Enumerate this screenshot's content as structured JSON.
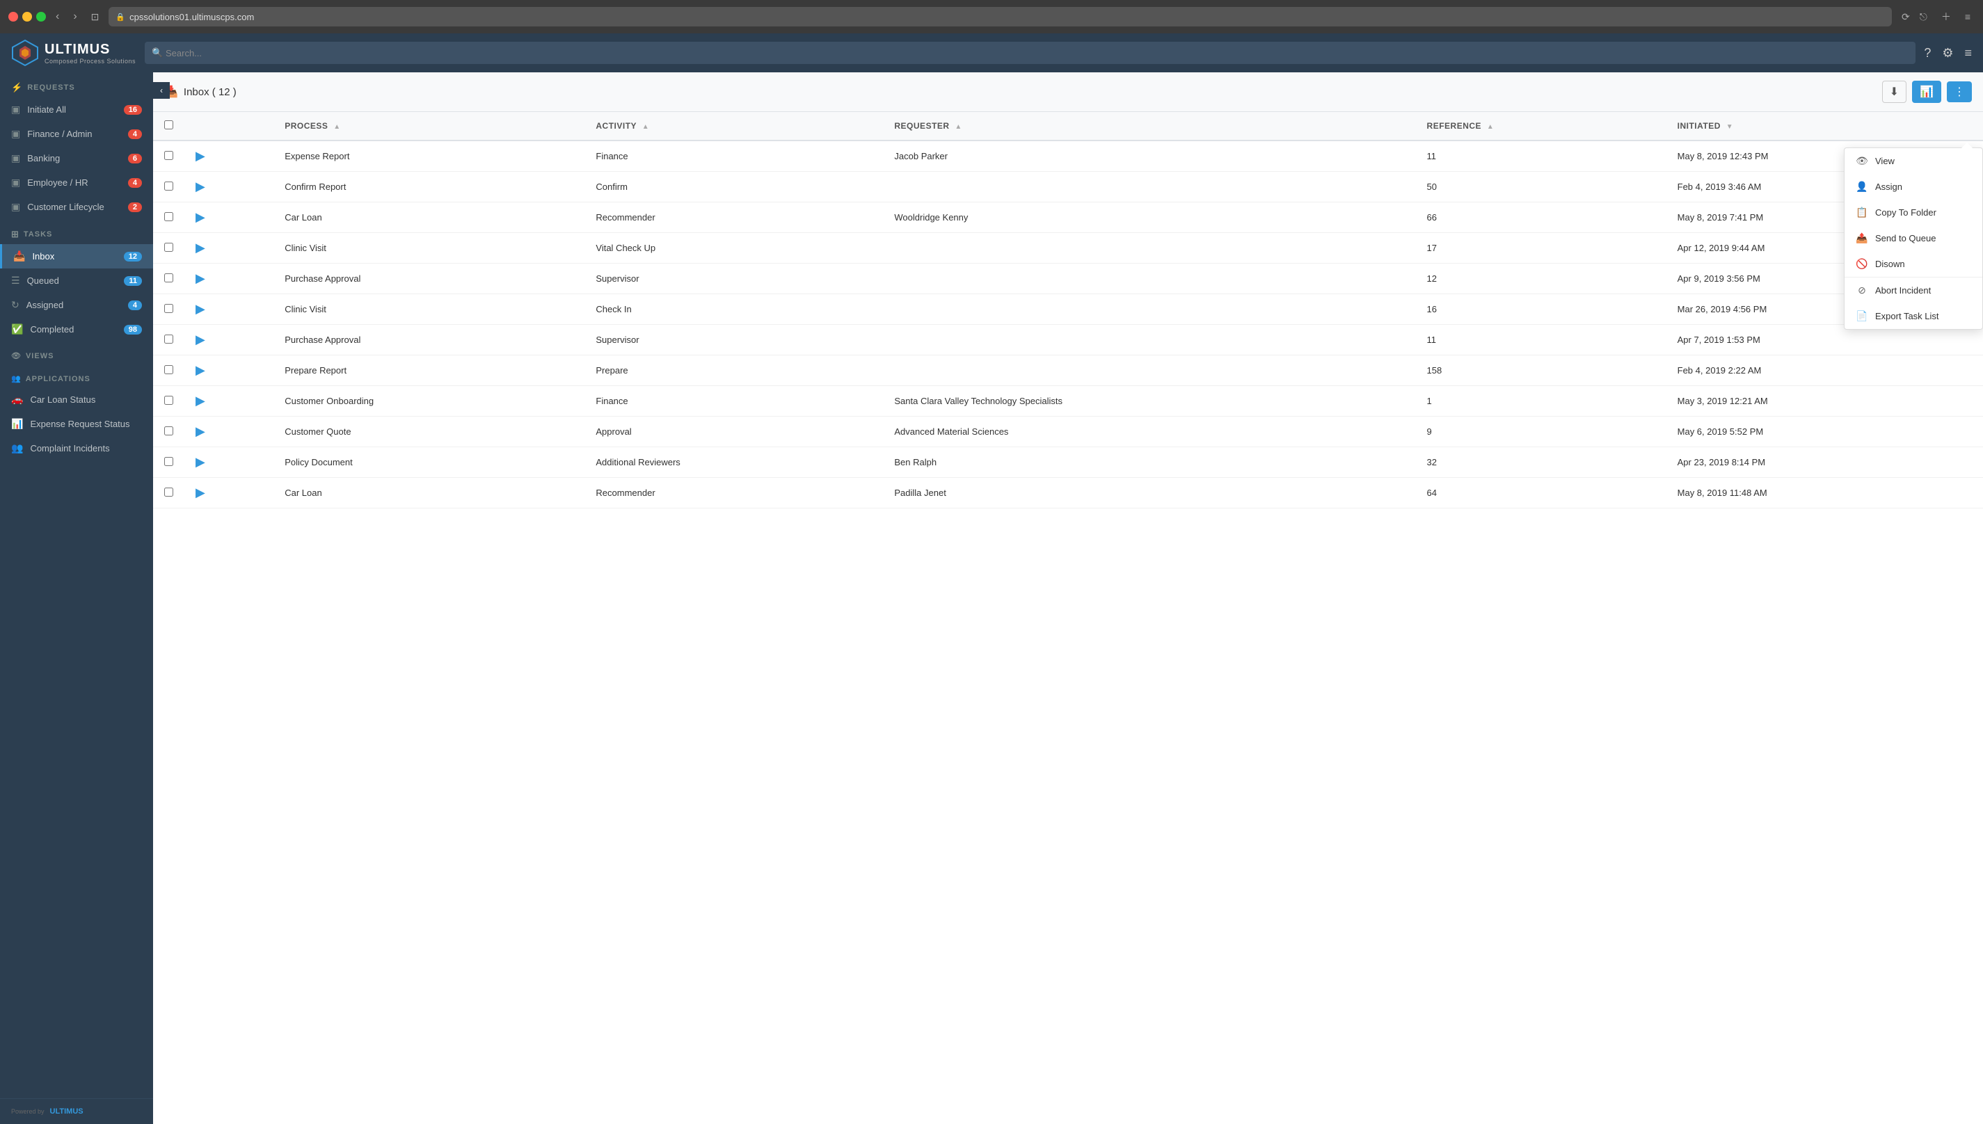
{
  "browser": {
    "url": "cpssolutions01.ultimuscps.com",
    "reload_label": "⟳"
  },
  "header": {
    "logo_name": "ULTIMUS",
    "logo_subtitle": "Composed Process Solutions",
    "search_placeholder": "Search...",
    "help_label": "?",
    "settings_label": "⚙",
    "menu_label": "≡"
  },
  "sidebar": {
    "requests_label": "REQUESTS",
    "tasks_label": "TASKS",
    "views_label": "VIEWS",
    "applications_label": "APPLICATIONS",
    "requests_items": [
      {
        "id": "initiate-all",
        "label": "Initiate All",
        "badge": "16",
        "badge_color": "red"
      },
      {
        "id": "finance-admin",
        "label": "Finance / Admin",
        "badge": "4",
        "badge_color": "red"
      },
      {
        "id": "banking",
        "label": "Banking",
        "badge": "6",
        "badge_color": "red"
      },
      {
        "id": "employee-hr",
        "label": "Employee / HR",
        "badge": "4",
        "badge_color": "red"
      },
      {
        "id": "customer-lifecycle",
        "label": "Customer Lifecycle",
        "badge": "2",
        "badge_color": "red"
      }
    ],
    "tasks_items": [
      {
        "id": "inbox",
        "label": "Inbox",
        "badge": "12",
        "badge_color": "blue",
        "active": true
      },
      {
        "id": "queued",
        "label": "Queued",
        "badge": "11",
        "badge_color": "blue"
      },
      {
        "id": "assigned",
        "label": "Assigned",
        "badge": "4",
        "badge_color": "blue"
      },
      {
        "id": "completed",
        "label": "Completed",
        "badge": "98",
        "badge_color": "blue"
      }
    ],
    "application_items": [
      {
        "id": "car-loan-status",
        "label": "Car Loan Status"
      },
      {
        "id": "expense-request-status",
        "label": "Expense Request Status"
      },
      {
        "id": "complaint-incidents",
        "label": "Complaint Incidents"
      }
    ],
    "powered_by": "Powered by"
  },
  "inbox": {
    "title": "Inbox ( 12 )"
  },
  "table": {
    "columns": [
      {
        "id": "process",
        "label": "PROCESS"
      },
      {
        "id": "activity",
        "label": "ACTIVITY"
      },
      {
        "id": "requester",
        "label": "REQUESTER"
      },
      {
        "id": "reference",
        "label": "REFERENCE"
      },
      {
        "id": "initiated",
        "label": "INITIATED"
      }
    ],
    "rows": [
      {
        "process": "Expense Report",
        "activity": "Finance",
        "requester": "Jacob Parker",
        "reference": "11",
        "initiated": "May 8, 2019 12:43 PM"
      },
      {
        "process": "Confirm Report",
        "activity": "Confirm",
        "requester": "",
        "reference": "50",
        "initiated": "Feb 4, 2019 3:46 AM"
      },
      {
        "process": "Car Loan",
        "activity": "Recommender",
        "requester": "Wooldridge Kenny",
        "reference": "66",
        "initiated": "May 8, 2019 7:41 PM"
      },
      {
        "process": "Clinic Visit",
        "activity": "Vital Check Up",
        "requester": "",
        "reference": "17",
        "initiated": "Apr 12, 2019 9:44 AM"
      },
      {
        "process": "Purchase Approval",
        "activity": "Supervisor",
        "requester": "",
        "reference": "12",
        "initiated": "Apr 9, 2019 3:56 PM"
      },
      {
        "process": "Clinic Visit",
        "activity": "Check In",
        "requester": "",
        "reference": "16",
        "initiated": "Mar 26, 2019 4:56 PM"
      },
      {
        "process": "Purchase Approval",
        "activity": "Supervisor",
        "requester": "",
        "reference": "11",
        "initiated": "Apr 7, 2019 1:53 PM"
      },
      {
        "process": "Prepare Report",
        "activity": "Prepare",
        "requester": "",
        "reference": "158",
        "initiated": "Feb 4, 2019 2:22 AM"
      },
      {
        "process": "Customer Onboarding",
        "activity": "Finance",
        "requester": "Santa Clara Valley Technology Specialists",
        "reference": "1",
        "initiated": "May 3, 2019 12:21 AM"
      },
      {
        "process": "Customer Quote",
        "activity": "Approval",
        "requester": "Advanced Material Sciences",
        "reference": "9",
        "initiated": "May 6, 2019 5:52 PM"
      },
      {
        "process": "Policy Document",
        "activity": "Additional Reviewers",
        "requester": "Ben Ralph",
        "reference": "32",
        "initiated": "Apr 23, 2019 8:14 PM"
      },
      {
        "process": "Car Loan",
        "activity": "Recommender",
        "requester": "Padilla Jenet",
        "reference": "64",
        "initiated": "May 8, 2019 11:48 AM"
      }
    ]
  },
  "context_menu": {
    "items": [
      {
        "id": "view",
        "label": "View",
        "icon": "👁"
      },
      {
        "id": "assign",
        "label": "Assign",
        "icon": "👤"
      },
      {
        "id": "copy-to-folder",
        "label": "Copy To Folder",
        "icon": "📋"
      },
      {
        "id": "send-to-queue",
        "label": "Send to Queue",
        "icon": "📤"
      },
      {
        "id": "disown",
        "label": "Disown",
        "icon": "🚫"
      },
      {
        "id": "abort-incident",
        "label": "Abort Incident",
        "icon": "⊘"
      },
      {
        "id": "export-task-list",
        "label": "Export Task List",
        "icon": "📄"
      }
    ]
  },
  "collapse_btn": "‹"
}
